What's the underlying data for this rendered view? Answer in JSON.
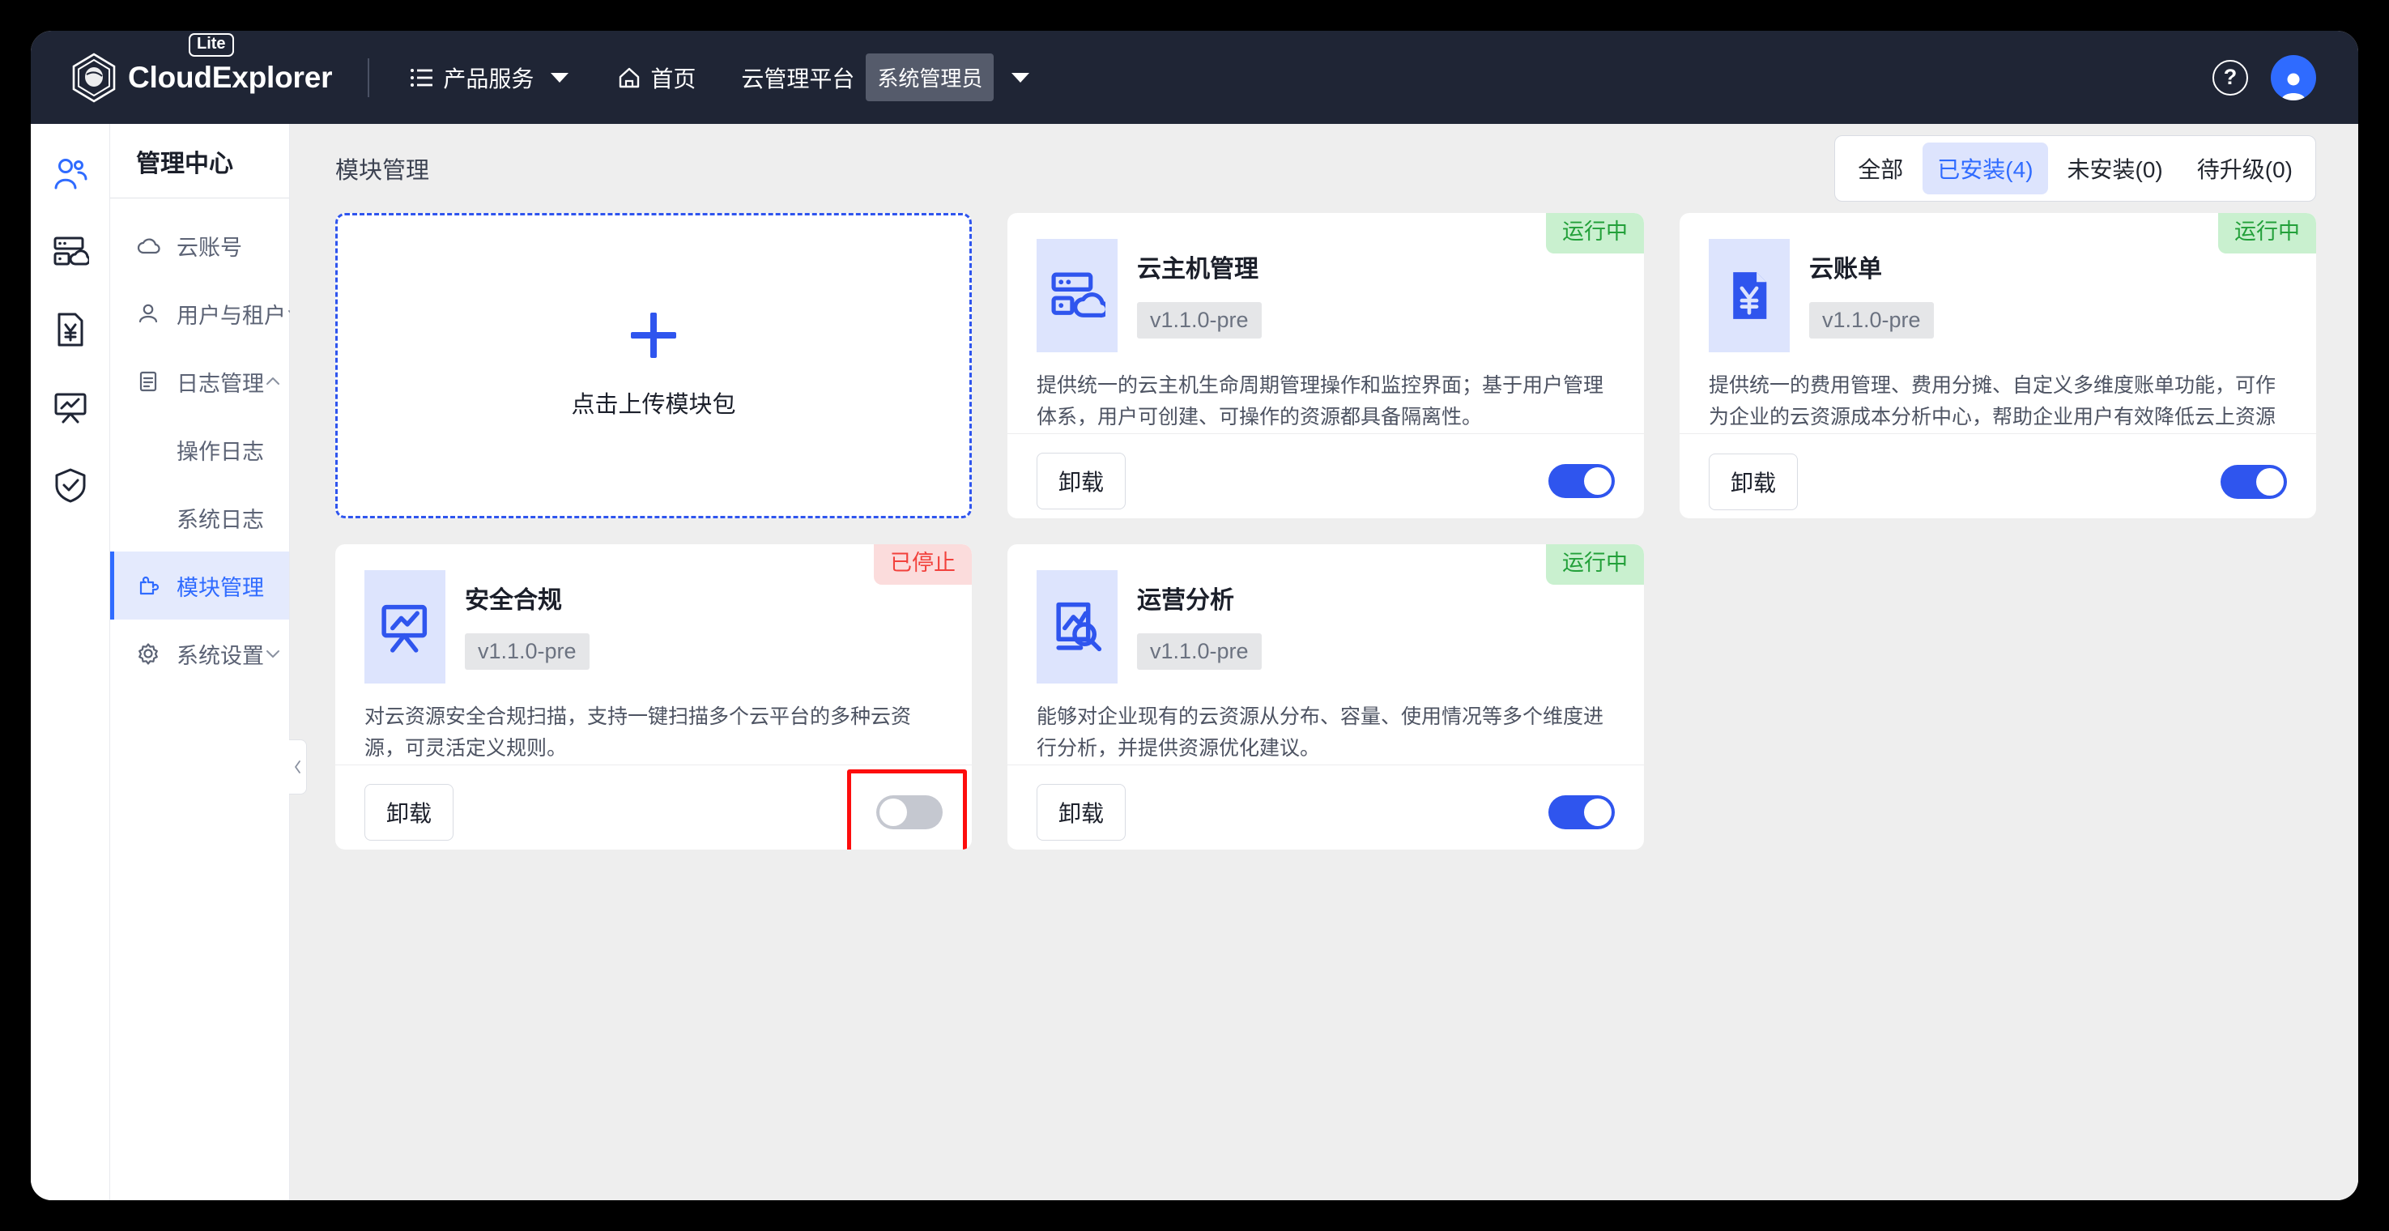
{
  "topbar": {
    "brand_name": "CloudExplorer",
    "lite_badge": "Lite",
    "nav": [
      {
        "icon": "menu-list-icon",
        "label": "产品服务",
        "has_caret": true
      },
      {
        "icon": "home-icon",
        "label": "首页",
        "has_caret": false
      }
    ],
    "platform_label": "云管理平台",
    "role_chip": "系统管理员",
    "help_icon": "?",
    "avatar_icon": "user-avatar-icon"
  },
  "rail": [
    {
      "name": "user-group-icon",
      "active": true
    },
    {
      "name": "server-cloud-icon",
      "active": false
    },
    {
      "name": "bill-yen-icon",
      "active": false
    },
    {
      "name": "chart-board-icon",
      "active": false
    },
    {
      "name": "shield-check-icon",
      "active": false
    }
  ],
  "sidebar": {
    "title": "管理中心",
    "items": [
      {
        "label": "云账号",
        "icon": "cloud-icon",
        "arrow": "none",
        "active": false,
        "sub": false
      },
      {
        "label": "用户与租户",
        "icon": "user-icon",
        "arrow": "down",
        "active": false,
        "sub": false
      },
      {
        "label": "日志管理",
        "icon": "log-doc-icon",
        "arrow": "up",
        "active": false,
        "sub": false
      },
      {
        "label": "操作日志",
        "icon": "",
        "arrow": "none",
        "active": false,
        "sub": true
      },
      {
        "label": "系统日志",
        "icon": "",
        "arrow": "none",
        "active": false,
        "sub": true
      },
      {
        "label": "模块管理",
        "icon": "puzzle-icon",
        "arrow": "none",
        "active": true,
        "sub": false
      },
      {
        "label": "系统设置",
        "icon": "gear-icon",
        "arrow": "down",
        "active": false,
        "sub": false
      }
    ],
    "collapse_icon": "chevron-left-icon"
  },
  "content": {
    "title": "模块管理",
    "filters": [
      {
        "label": "全部",
        "selected": false
      },
      {
        "label": "已安装(4)",
        "selected": true
      },
      {
        "label": "未安装(0)",
        "selected": false
      },
      {
        "label": "待升级(0)",
        "selected": false
      }
    ],
    "upload_card": {
      "icon": "plus-icon",
      "label": "点击上传模块包"
    },
    "uninstall_label": "卸载",
    "modules": [
      {
        "name": "云主机管理",
        "version": "v1.1.0-pre",
        "description": "提供统一的云主机生命周期管理操作和监控界面；基于用户管理体系，用户可创建、可操作的资源都具备隔离性。",
        "status": "运行中",
        "status_type": "running",
        "icon": "server-cloud-icon",
        "enabled": true,
        "highlighted": false
      },
      {
        "name": "云账单",
        "version": "v1.1.0-pre",
        "description": "提供统一的费用管理、费用分摊、自定义多维度账单功能，可作为企业的云资源成本分析中心，帮助企业用户有效降低云上资源的成",
        "status": "运行中",
        "status_type": "running",
        "icon": "bill-yen-icon",
        "enabled": true,
        "highlighted": false
      },
      {
        "name": "安全合规",
        "version": "v1.1.0-pre",
        "description": "对云资源安全合规扫描，支持一键扫描多个云平台的多种云资源，可灵活定义规则。",
        "status": "已停止",
        "status_type": "stopped",
        "icon": "chart-board-icon",
        "enabled": false,
        "highlighted": true
      },
      {
        "name": "运营分析",
        "version": "v1.1.0-pre",
        "description": "能够对企业现有的云资源从分布、容量、使用情况等多个维度进行分析，并提供资源优化建议。",
        "status": "运行中",
        "status_type": "running",
        "icon": "report-search-icon",
        "enabled": true,
        "highlighted": false
      }
    ]
  },
  "colors": {
    "brand_dark": "#1f2535",
    "accent_blue": "#2f55ee",
    "link_blue": "#2f6bff",
    "running_bg": "#c9f0cf",
    "running_text": "#23a03a",
    "stopped_bg": "#fbdcdc",
    "stopped_text": "#f2413c",
    "highlight_red": "#fd0d0d"
  }
}
